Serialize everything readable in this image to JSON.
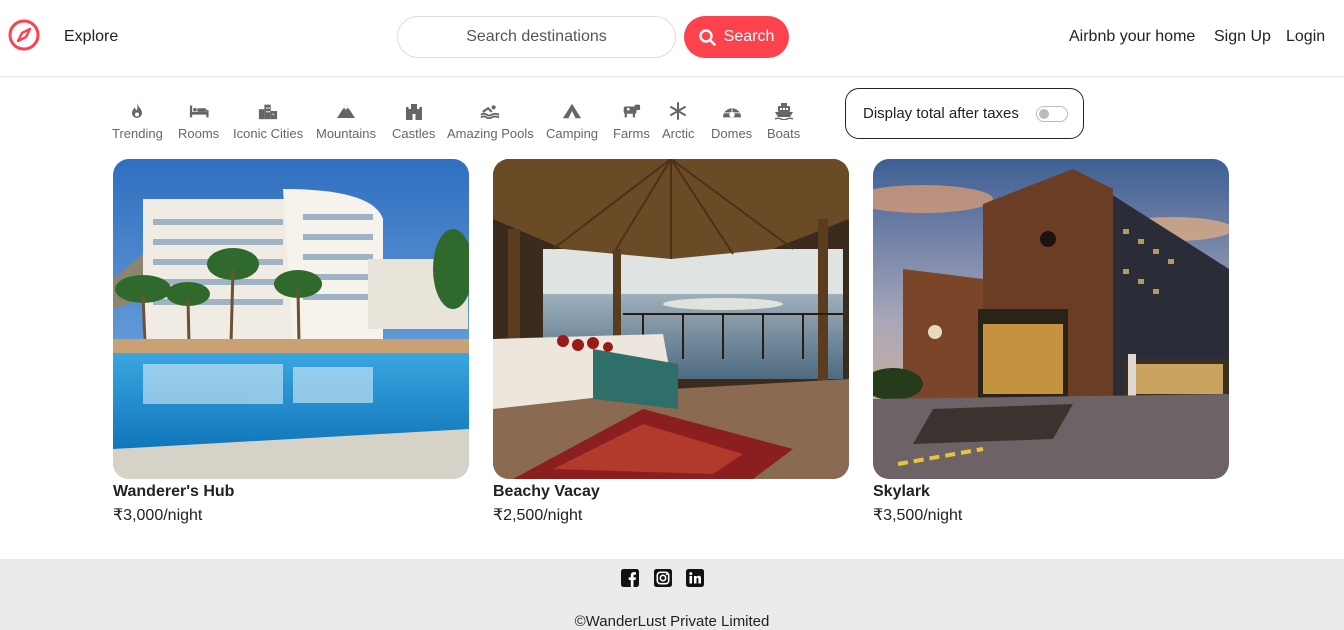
{
  "nav": {
    "explore": "Explore",
    "search_placeholder": "Search destinations",
    "search_button": "Search",
    "host": "Airbnb your home",
    "signup": "Sign Up",
    "login": "Login"
  },
  "colors": {
    "accent": "#fe424d"
  },
  "filters": [
    {
      "label": "Trending",
      "icon": "fire-icon"
    },
    {
      "label": "Rooms",
      "icon": "bed-icon"
    },
    {
      "label": "Iconic Cities",
      "icon": "city-icon"
    },
    {
      "label": "Mountains",
      "icon": "mountain-icon"
    },
    {
      "label": "Castles",
      "icon": "castle-icon"
    },
    {
      "label": "Amazing Pools",
      "icon": "swimmer-icon"
    },
    {
      "label": "Camping",
      "icon": "tent-icon"
    },
    {
      "label": "Farms",
      "icon": "cow-icon"
    },
    {
      "label": "Arctic",
      "icon": "snowflake-icon"
    },
    {
      "label": "Domes",
      "icon": "igloo-icon"
    },
    {
      "label": "Boats",
      "icon": "ferry-icon"
    }
  ],
  "tax_toggle": {
    "label": "Display total after taxes",
    "on": false
  },
  "listings": [
    {
      "title": "Wanderer's Hub",
      "price": "₹3,000/night",
      "image": "resort hotel with pool and palm trees"
    },
    {
      "title": "Beachy Vacay",
      "price": "₹2,500/night",
      "image": "thatched beach hut with bed facing the sea"
    },
    {
      "title": "Skylark",
      "price": "₹3,500/night",
      "image": "modern brick hotel at dusk"
    }
  ],
  "footer": {
    "social": [
      "facebook-icon",
      "instagram-icon",
      "linkedin-icon"
    ],
    "copyright": "©WanderLust Private Limited"
  }
}
